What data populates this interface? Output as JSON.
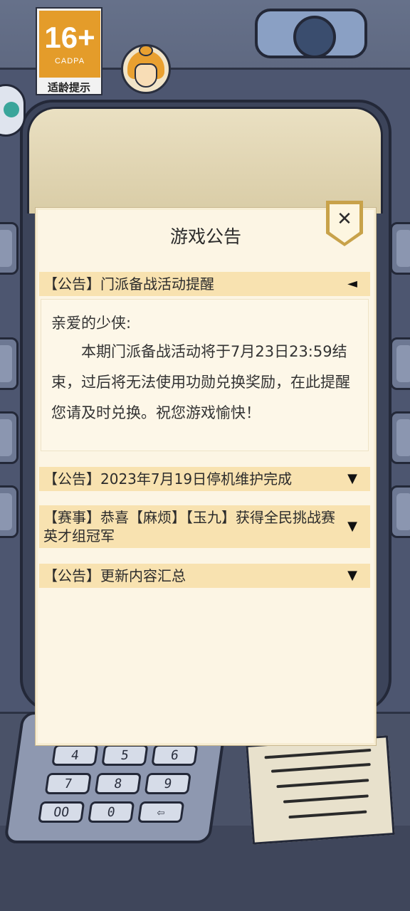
{
  "age_rating": {
    "number": "16+",
    "org": "CADPA",
    "label": "适龄提示"
  },
  "dialog": {
    "title": "游戏公告",
    "close_symbol": "✕",
    "notices": [
      {
        "title": "【公告】门派备战活动提醒",
        "expanded": true,
        "arrow": "◄",
        "greeting": "亲爱的少侠:",
        "body": "本期门派备战活动将于7月23日23:59结束，过后将无法使用功勋兑换奖励，在此提醒您请及时兑换。祝您游戏愉快！"
      },
      {
        "title": "【公告】2023年7月19日停机维护完成",
        "expanded": false,
        "arrow": "▼"
      },
      {
        "title": "【赛事】恭喜【麻烦】【玉九】获得全民挑战赛英才组冠军",
        "expanded": false,
        "arrow": "▼"
      },
      {
        "title": "【公告】更新内容汇总",
        "expanded": false,
        "arrow": "▼"
      }
    ]
  },
  "keypad": {
    "keys": [
      "4",
      "5",
      "6",
      "7",
      "8",
      "9",
      "OO",
      "0",
      "⇦"
    ]
  }
}
